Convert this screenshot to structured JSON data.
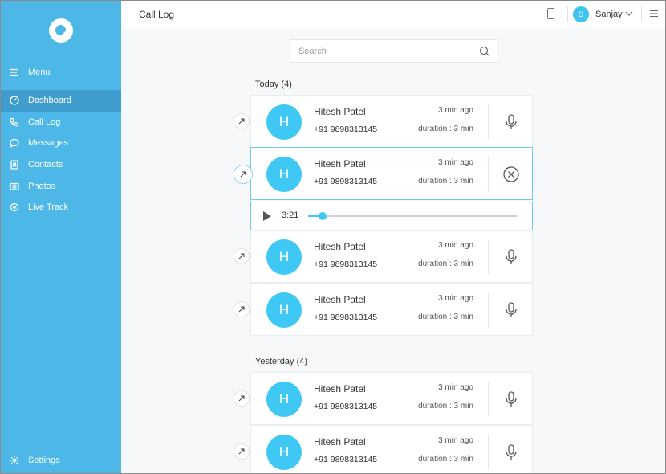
{
  "sidebar": {
    "menu_label": "Menu",
    "items": [
      {
        "label": "Dashboard",
        "icon": "dashboard-icon",
        "active": true
      },
      {
        "label": "Call Log",
        "icon": "phone-icon",
        "active": false
      },
      {
        "label": "Messages",
        "icon": "chat-icon",
        "active": false
      },
      {
        "label": "Contacts",
        "icon": "contacts-icon",
        "active": false
      },
      {
        "label": "Photos",
        "icon": "photo-icon",
        "active": false
      },
      {
        "label": "Live Track",
        "icon": "location-icon",
        "active": false
      }
    ],
    "settings_label": "Settings"
  },
  "topbar": {
    "title": "Call Log",
    "user_initial": "S",
    "user_name": "Sanjay"
  },
  "search": {
    "placeholder": "Search"
  },
  "sections": [
    {
      "label": "Today (4)",
      "calls": [
        {
          "initial": "H",
          "name": "Hitesh Patel",
          "number": "+91 9898313145",
          "time_ago": "3 min ago",
          "duration": "duration : 3 min",
          "action": "mic"
        },
        {
          "initial": "H",
          "name": "Hitesh Patel",
          "number": "+91 9898313145",
          "time_ago": "3 min ago",
          "duration": "duration : 3 min",
          "action": "close",
          "selected": true
        },
        {
          "initial": "H",
          "name": "Hitesh Patel",
          "number": "+91 9898313145",
          "time_ago": "3 min ago",
          "duration": "duration : 3 min",
          "action": "mic"
        },
        {
          "initial": "H",
          "name": "Hitesh Patel",
          "number": "+91 9898313145",
          "time_ago": "3 min ago",
          "duration": "duration : 3 min",
          "action": "mic"
        }
      ]
    },
    {
      "label": "Yesterday (4)",
      "calls": [
        {
          "initial": "H",
          "name": "Hitesh Patel",
          "number": "+91 9898313145",
          "time_ago": "3 min ago",
          "duration": "duration : 3 min",
          "action": "mic"
        },
        {
          "initial": "H",
          "name": "Hitesh Patel",
          "number": "+91 9898313145",
          "time_ago": "3 min ago",
          "duration": "duration : 3 min",
          "action": "mic"
        }
      ]
    }
  ],
  "player": {
    "time": "3:21",
    "progress": 0.07
  },
  "colors": {
    "sidebar": "#4db8e8",
    "sidebar_active": "#3e9dcc",
    "accent": "#3fc8f4"
  }
}
